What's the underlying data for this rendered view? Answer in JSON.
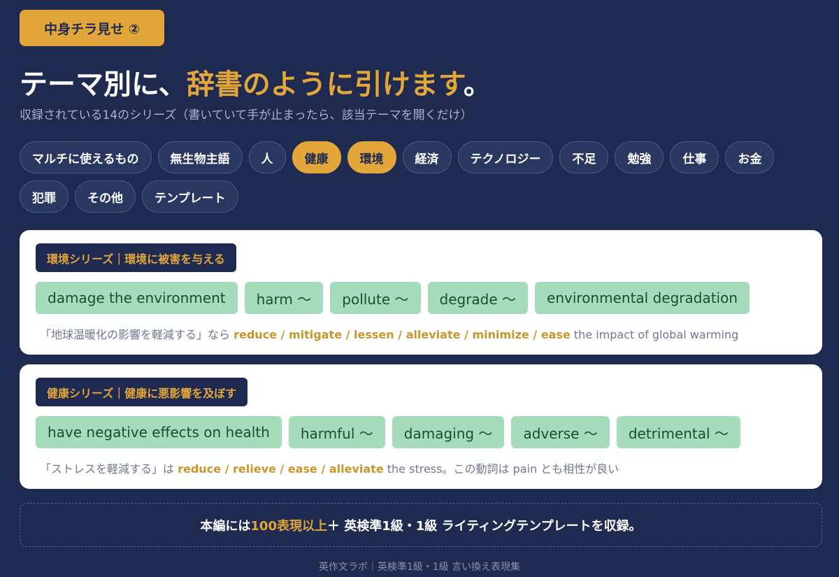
{
  "badge": "中身チラ見せ ②",
  "title": {
    "part1": "テーマ別に、",
    "accent": "辞書のように引けます",
    "end": "。"
  },
  "subtitle": "収録されている14のシリーズ（書いていて手が止まったら、該当テーマを開くだけ）",
  "themes": [
    {
      "label": "マルチに使えるもの",
      "active": false
    },
    {
      "label": "無生物主語",
      "active": false
    },
    {
      "label": "人",
      "active": false
    },
    {
      "label": "健康",
      "active": true
    },
    {
      "label": "環境",
      "active": true
    },
    {
      "label": "経済",
      "active": false
    },
    {
      "label": "テクノロジー",
      "active": false
    },
    {
      "label": "不足",
      "active": false
    },
    {
      "label": "勉強",
      "active": false
    },
    {
      "label": "仕事",
      "active": false
    },
    {
      "label": "お金",
      "active": false
    },
    {
      "label": "犯罪",
      "active": false
    },
    {
      "label": "その他",
      "active": false
    },
    {
      "label": "テンプレート",
      "active": false
    }
  ],
  "cards": [
    {
      "label": "環境シリーズ｜環境に被害を与える",
      "chips": [
        "damage the environment",
        "harm 〜",
        "pollute 〜",
        "degrade 〜",
        "environmental degradation"
      ],
      "note_pre": "「地球温暖化の影響を軽減する」なら ",
      "note_hl": "reduce / mitigate / lessen / alleviate / minimize / ease",
      "note_post": " the impact of global warming"
    },
    {
      "label": "健康シリーズ｜健康に悪影響を及ぼす",
      "chips": [
        "have negative effects on health",
        "harmful 〜",
        "damaging 〜",
        "adverse 〜",
        "detrimental 〜"
      ],
      "note_pre": "「ストレスを軽減する」は ",
      "note_hl": "reduce / relieve / ease / alleviate",
      "note_post": " the stress。この動詞は pain とも相性が良い"
    }
  ],
  "footer": {
    "pre": "本編には ",
    "hl": "100表現以上",
    "post": " ＋ 英検準1級・1級 ライティングテンプレートを収録。"
  },
  "credit": "英作文ラボ｜英検準1級・1級 言い換え表現集",
  "colors": {
    "background": "#1e2a4f",
    "accent": "#e2a63b",
    "chip": "#a6dcbc",
    "chip_text": "#1d4a37"
  }
}
